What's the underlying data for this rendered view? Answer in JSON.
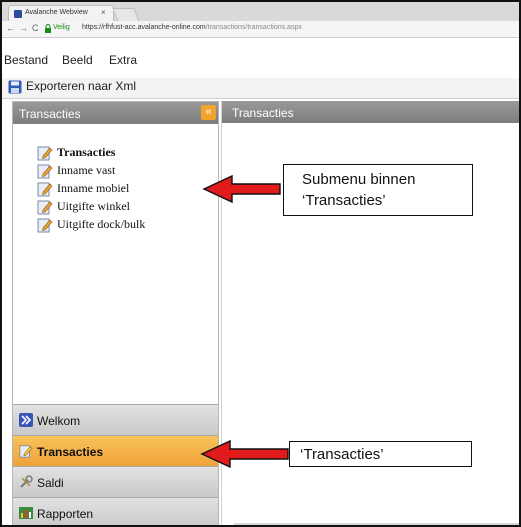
{
  "browser": {
    "tab_title": "Avalanche Webview",
    "tab_close": "×",
    "secure_label": "Veilig",
    "url_host": "https://rfhfust-acc.avalanche-online.com",
    "url_path": "/transactions/transactions.aspx",
    "nav_back": "←",
    "nav_forward": "→",
    "nav_reload": "C"
  },
  "menubar": {
    "items": [
      "Bestand",
      "Beeld",
      "Extra"
    ]
  },
  "toolbar": {
    "export_label": "Exporteren naar Xml"
  },
  "left_panel": {
    "header": "Transacties",
    "collapse_glyph": "«",
    "tree": [
      {
        "label": "Transacties",
        "bold": true
      },
      {
        "label": "Inname vast",
        "bold": false
      },
      {
        "label": "Inname mobiel",
        "bold": false
      },
      {
        "label": "Uitgifte winkel",
        "bold": false
      },
      {
        "label": "Uitgifte dock/bulk",
        "bold": false
      }
    ],
    "nav_buttons": [
      {
        "label": "Welkom",
        "icon": "chevrons-icon",
        "active": false
      },
      {
        "label": "Transacties",
        "icon": "edit-icon",
        "active": true
      },
      {
        "label": "Saldi",
        "icon": "tools-icon",
        "active": false
      },
      {
        "label": "Rapporten",
        "icon": "chart-icon",
        "active": false
      }
    ]
  },
  "right_panel": {
    "header": "Transacties"
  },
  "annotations": {
    "submenu_line1": "Submenu binnen",
    "submenu_line2": "‘Transacties’",
    "transacties_label": "‘Transacties’"
  },
  "colors": {
    "accent_orange": "#f0a33a",
    "header_gray": "#8a8a8a",
    "arrow_red": "#e11b1b"
  }
}
